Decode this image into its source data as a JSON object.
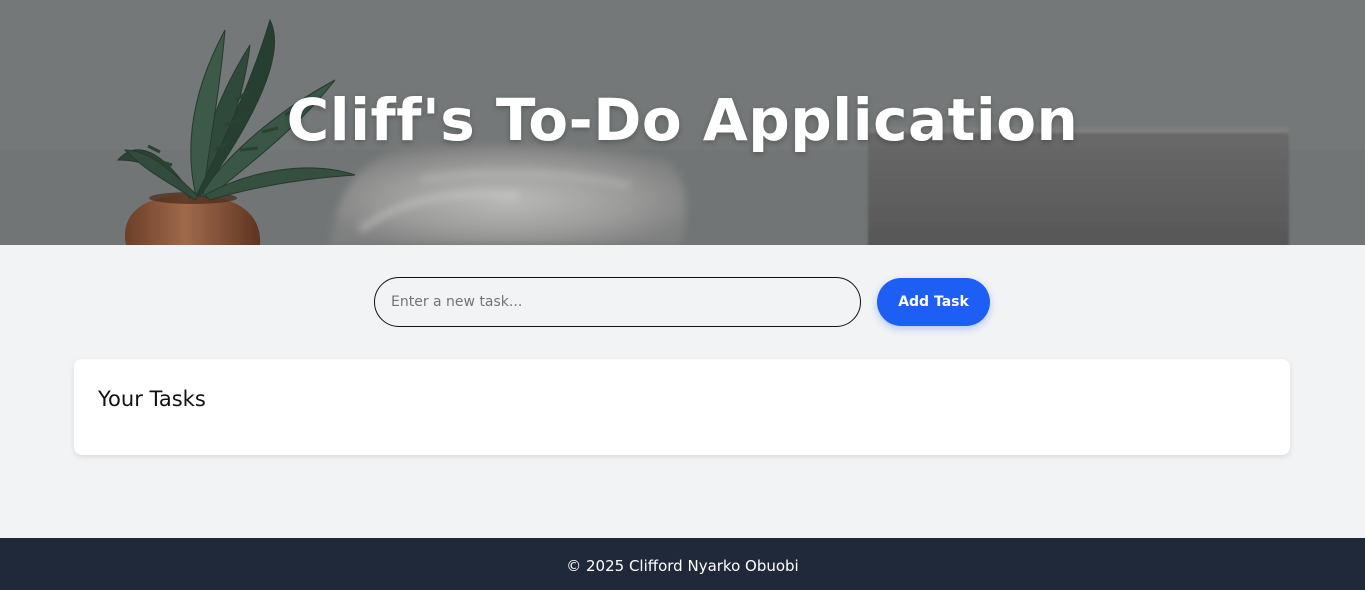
{
  "header": {
    "title": "Cliff's To-Do Application"
  },
  "task_form": {
    "input_placeholder": "Enter a new task...",
    "input_value": "",
    "add_button_label": "Add Task"
  },
  "tasks_section": {
    "heading": "Your Tasks",
    "tasks": []
  },
  "footer": {
    "text": "© 2025 Clifford Nyarko Obuobi"
  },
  "colors": {
    "accent": "#1d5ff5",
    "footer_bg": "#1f293a",
    "page_bg": "#f2f3f5"
  }
}
